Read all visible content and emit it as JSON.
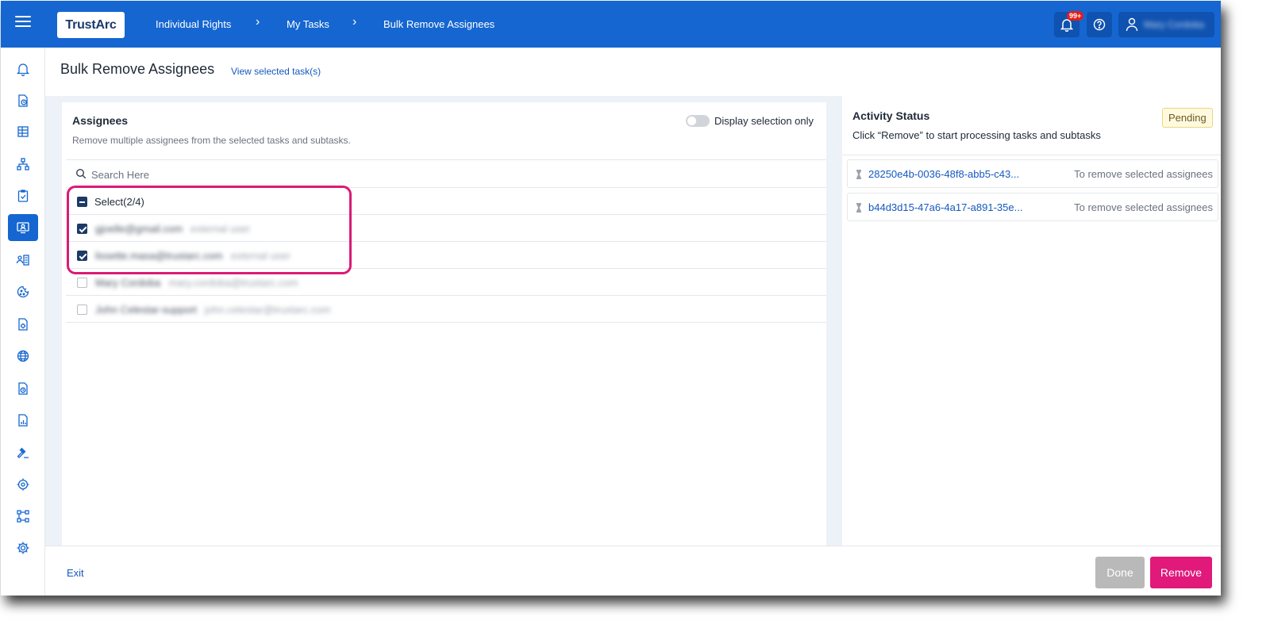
{
  "app": {
    "logo_text": "TrustArc",
    "brand_color": "#1566d0",
    "accent_color": "#e0197b"
  },
  "breadcrumb": [
    {
      "label": "Individual Rights"
    },
    {
      "label": "My Tasks"
    },
    {
      "label": "Bulk Remove Assignees"
    }
  ],
  "topbar": {
    "notification_badge": "99+",
    "user_name": "Mary Cordoba",
    "icons": [
      "bell-icon",
      "help-icon",
      "user-icon"
    ]
  },
  "sidebar": {
    "icons": [
      "bell-icon",
      "clock-doc-icon",
      "table-icon",
      "org-chart-icon",
      "clipboard-check-icon",
      "user-screen-icon",
      "user-list-icon",
      "cookie-icon",
      "doc-gear-icon",
      "globe-icon",
      "doc-clock-icon",
      "doc-chart-icon",
      "gavel-icon",
      "target-icon",
      "workflow-icon",
      "gear-icon"
    ],
    "active_index": 5
  },
  "header": {
    "title": "Bulk Remove Assignees",
    "view_link": "View selected task(s)"
  },
  "assignees": {
    "title": "Assignees",
    "subtitle": "Remove multiple assignees from the selected tasks and subtasks.",
    "toggle_label": "Display selection only",
    "toggle_on": false,
    "search_placeholder": "Search Here",
    "select_all_label": "Select(2/4)",
    "rows": [
      {
        "name": "gjoelle@gmail.com",
        "email": "external user",
        "checked": true
      },
      {
        "name": "lissette.masa@trustarc.com",
        "email": "external user",
        "checked": true
      },
      {
        "name": "Mary Cordoba",
        "email": "mary.cordoba@trustarc.com",
        "checked": false
      },
      {
        "name": "John Celestar-support",
        "email": "john.celestar@trustarc.com",
        "checked": false
      }
    ]
  },
  "activity": {
    "title": "Activity Status",
    "subtitle": "Click “Remove” to start processing tasks and subtasks",
    "status_badge": "Pending",
    "tasks": [
      {
        "id": "28250e4b-0036-48f8-abb5-c43...",
        "status": "To remove selected assignees"
      },
      {
        "id": "b44d3d15-47a6-4a17-a891-35e...",
        "status": "To remove selected assignees"
      }
    ]
  },
  "footer": {
    "exit_label": "Exit",
    "done_label": "Done",
    "remove_label": "Remove"
  }
}
